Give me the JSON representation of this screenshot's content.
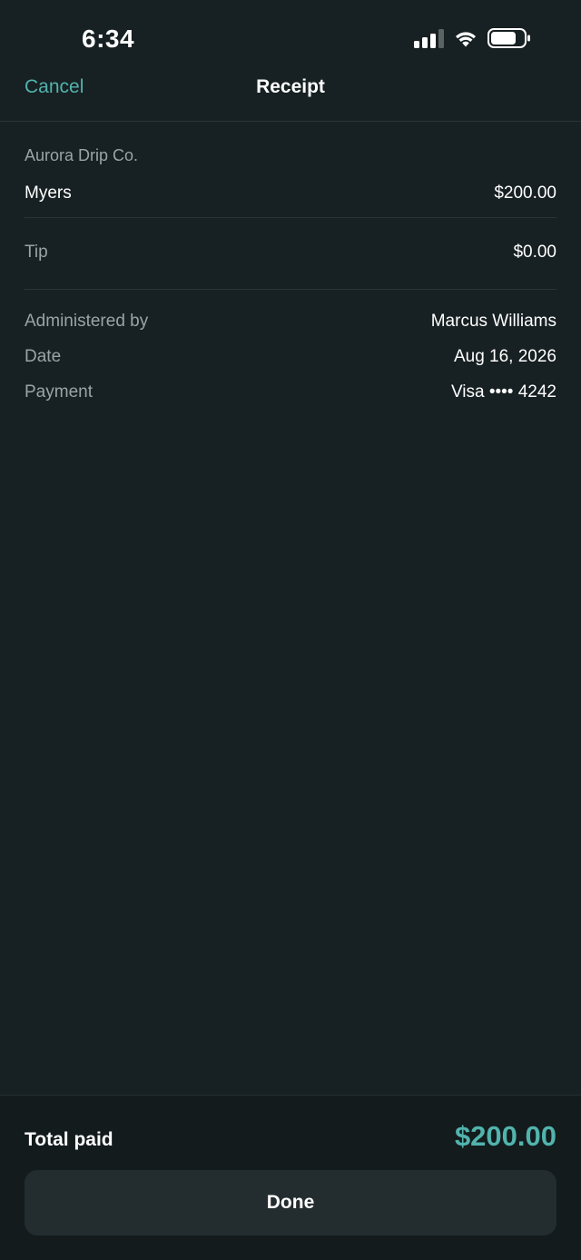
{
  "status_bar": {
    "time": "6:34",
    "icons": [
      "signal-icon",
      "wifi-icon",
      "battery-icon"
    ]
  },
  "nav": {
    "cancel_label": "Cancel",
    "title": "Receipt"
  },
  "receipt": {
    "merchant": "Aurora Drip Co.",
    "item": {
      "label": "Myers",
      "value": "$200.00"
    },
    "tip": {
      "label": "Tip",
      "value": "$0.00"
    },
    "details": [
      {
        "label": "Administered by",
        "value": "Marcus Williams"
      },
      {
        "label": "Date",
        "value": "Aug 16, 2026"
      },
      {
        "label": "Payment",
        "value": "Visa •••• 4242"
      }
    ]
  },
  "footer": {
    "total_label": "Total paid",
    "total_value": "$200.00",
    "done_label": "Done"
  },
  "colors": {
    "background": "#172022",
    "accent": "#52b3ad",
    "muted_text": "#9aa4a6",
    "divider": "#2a3436",
    "button_bg": "#232c2e"
  }
}
